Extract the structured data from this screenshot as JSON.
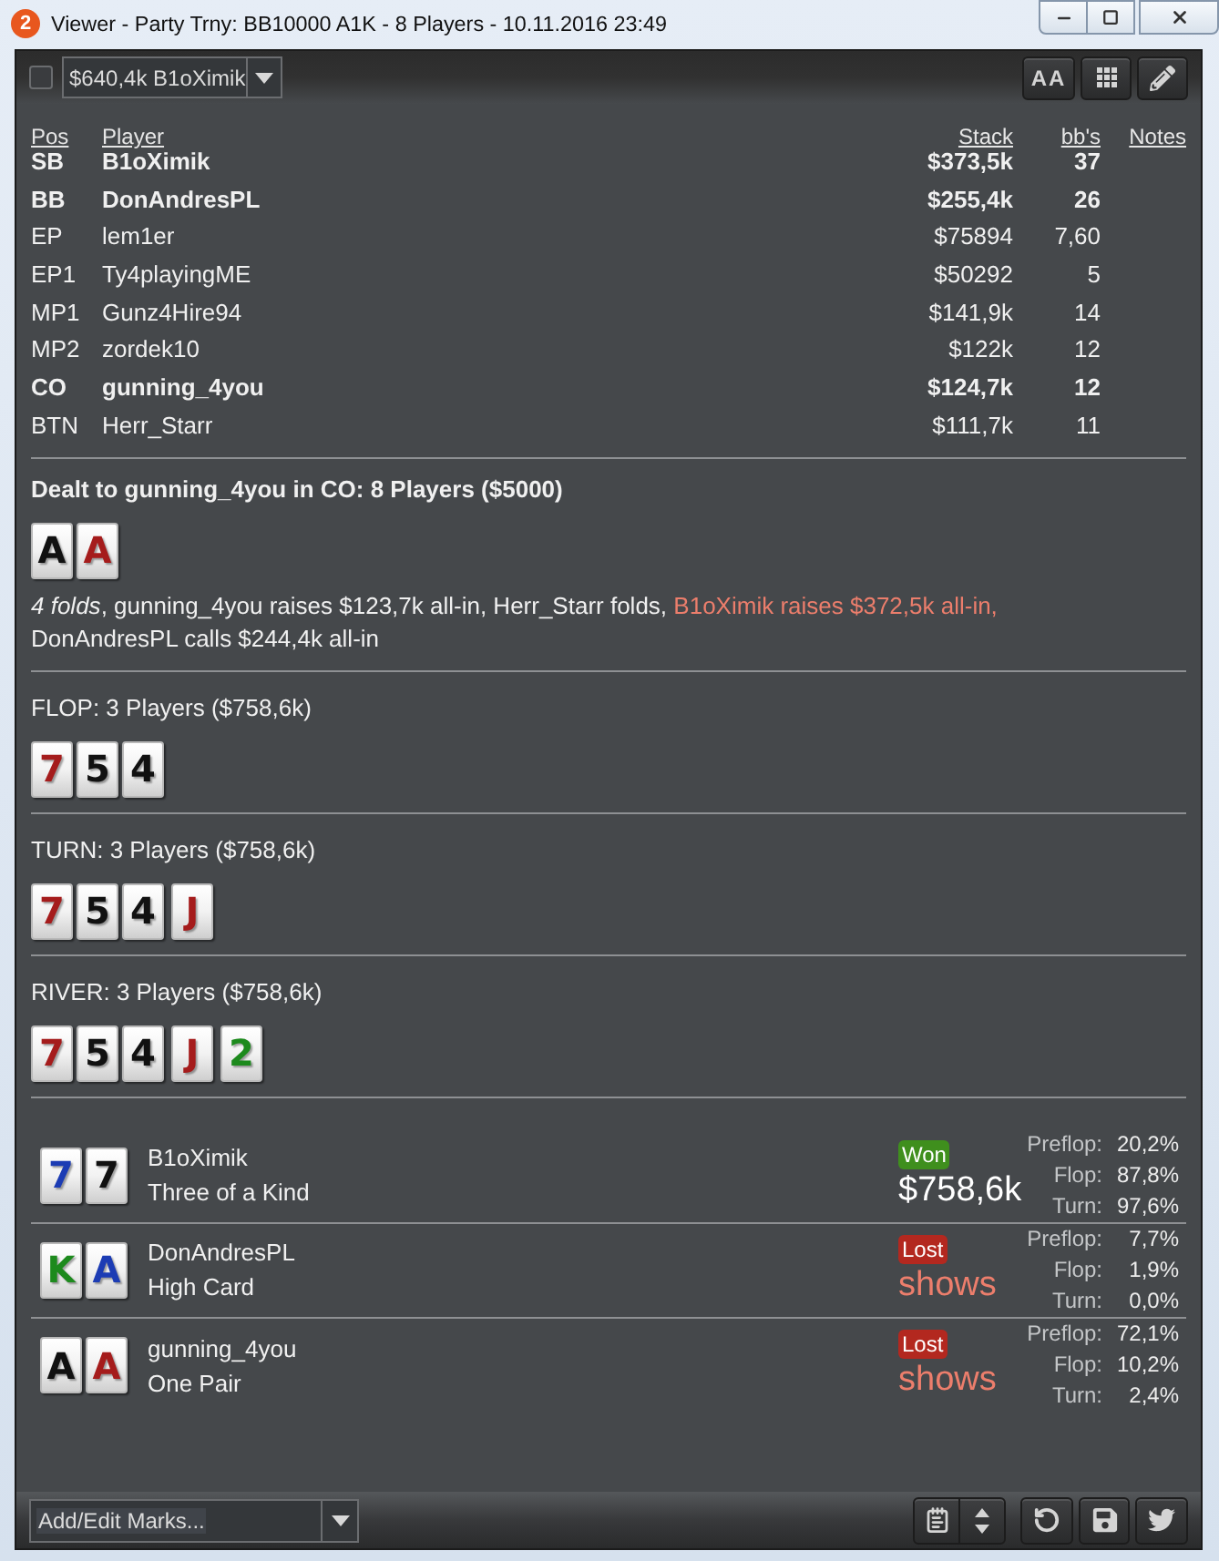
{
  "window": {
    "app_badge": "2",
    "title": "Viewer - Party Trny: BB10000 A1K - 8 Players - 10.11.2016 23:49"
  },
  "toolbar": {
    "select_checkbox": {
      "checked": false
    },
    "hand_filter": {
      "value": "$640,4k B1oXimik"
    },
    "buttons": [
      {
        "kind": "font_size",
        "label": "AA"
      },
      {
        "kind": "grid"
      },
      {
        "kind": "edit"
      }
    ]
  },
  "players_table": {
    "columns": [
      "Pos",
      "Player",
      "Stack",
      "bb's",
      "Notes"
    ],
    "rows": [
      {
        "pos": "SB",
        "player": "B1oXimik",
        "stack": "$373,5k",
        "bbs": "37",
        "highlighted": true
      },
      {
        "pos": "BB",
        "player": "DonAndresPL",
        "stack": "$255,4k",
        "bbs": "26",
        "highlighted": true
      },
      {
        "pos": "EP",
        "player": "lem1er",
        "stack": "$75894",
        "bbs": "7,60",
        "highlighted": false
      },
      {
        "pos": "EP1",
        "player": "Ty4playingME",
        "stack": "$50292",
        "bbs": "5",
        "highlighted": false
      },
      {
        "pos": "MP1",
        "player": "Gunz4Hire94",
        "stack": "$141,9k",
        "bbs": "14",
        "highlighted": false
      },
      {
        "pos": "MP2",
        "player": "zordek10",
        "stack": "$122k",
        "bbs": "12",
        "highlighted": false
      },
      {
        "pos": "CO",
        "player": "gunning_4you",
        "stack": "$124,7k",
        "bbs": "12",
        "highlighted": true
      },
      {
        "pos": "BTN",
        "player": "Herr_Starr",
        "stack": "$111,7k",
        "bbs": "11",
        "highlighted": false
      }
    ]
  },
  "streets": [
    {
      "kind": "preflop",
      "title": "Dealt to gunning_4you in CO: 8 Players ($5000)",
      "cards": [
        {
          "rank": "A",
          "color": "#111111"
        },
        {
          "rank": "A",
          "color": "#a51c1c"
        }
      ],
      "actions": [
        {
          "text": "*4 folds*, gunning_4you raises $123,7k all-in, Herr_Starr folds,",
          "highlight": false
        },
        {
          "text": "B1oXimik raises $372,5k all-in,",
          "highlight": true
        },
        {
          "text": "DonAndresPL calls $244,4k all-in",
          "highlight": false
        }
      ]
    },
    {
      "kind": "board",
      "title": "FLOP: 3 Players ($758,6k)",
      "cards": [
        {
          "rank": "7",
          "color": "#a51c1c"
        },
        {
          "rank": "5",
          "color": "#111111"
        },
        {
          "rank": "4",
          "color": "#111111"
        }
      ]
    },
    {
      "kind": "board",
      "title": "TURN: 3 Players ($758,6k)",
      "cards": [
        {
          "rank": "7",
          "color": "#a51c1c"
        },
        {
          "rank": "5",
          "color": "#111111"
        },
        {
          "rank": "4",
          "color": "#111111"
        },
        {
          "rank": "J",
          "color": "#a51c1c"
        }
      ]
    },
    {
      "kind": "board",
      "title": "RIVER: 3 Players ($758,6k)",
      "cards": [
        {
          "rank": "7",
          "color": "#a51c1c"
        },
        {
          "rank": "5",
          "color": "#111111"
        },
        {
          "rank": "4",
          "color": "#111111"
        },
        {
          "rank": "J",
          "color": "#a51c1c"
        },
        {
          "rank": "2",
          "color": "#1d8a1d"
        }
      ]
    }
  ],
  "showdown": [
    {
      "cards": [
        {
          "rank": "7",
          "color": "#1c3cb4"
        },
        {
          "rank": "7",
          "color": "#111111"
        }
      ],
      "player": "B1oXimik",
      "hand": "Three of a Kind",
      "won": true,
      "badge": "Won",
      "amount": "$758,6k",
      "equity": [
        {
          "label": "Preflop:",
          "value": "20,2%"
        },
        {
          "label": "Flop:",
          "value": "87,8%"
        },
        {
          "label": "Turn:",
          "value": "97,6%"
        }
      ]
    },
    {
      "cards": [
        {
          "rank": "K",
          "color": "#1d8a1d"
        },
        {
          "rank": "A",
          "color": "#1c3cb4"
        }
      ],
      "player": "DonAndresPL",
      "hand": "High Card",
      "won": false,
      "badge": "Lost",
      "amount": "shows",
      "equity": [
        {
          "label": "Preflop:",
          "value": "7,7%"
        },
        {
          "label": "Flop:",
          "value": "1,9%"
        },
        {
          "label": "Turn:",
          "value": "0,0%"
        }
      ]
    },
    {
      "cards": [
        {
          "rank": "A",
          "color": "#111111"
        },
        {
          "rank": "A",
          "color": "#a51c1c"
        }
      ],
      "player": "gunning_4you",
      "hand": "One Pair",
      "won": false,
      "badge": "Lost",
      "amount": "shows",
      "equity": [
        {
          "label": "Preflop:",
          "value": "72,1%"
        },
        {
          "label": "Flop:",
          "value": "10,2%"
        },
        {
          "label": "Turn:",
          "value": "2,4%"
        }
      ]
    }
  ],
  "footer": {
    "marks_dropdown": {
      "value": "Add/Edit Marks..."
    },
    "buttons": [
      {
        "kind": "notepad"
      },
      {
        "kind": "spinner"
      },
      {
        "kind": "refresh"
      },
      {
        "kind": "save"
      },
      {
        "kind": "bird"
      }
    ]
  }
}
